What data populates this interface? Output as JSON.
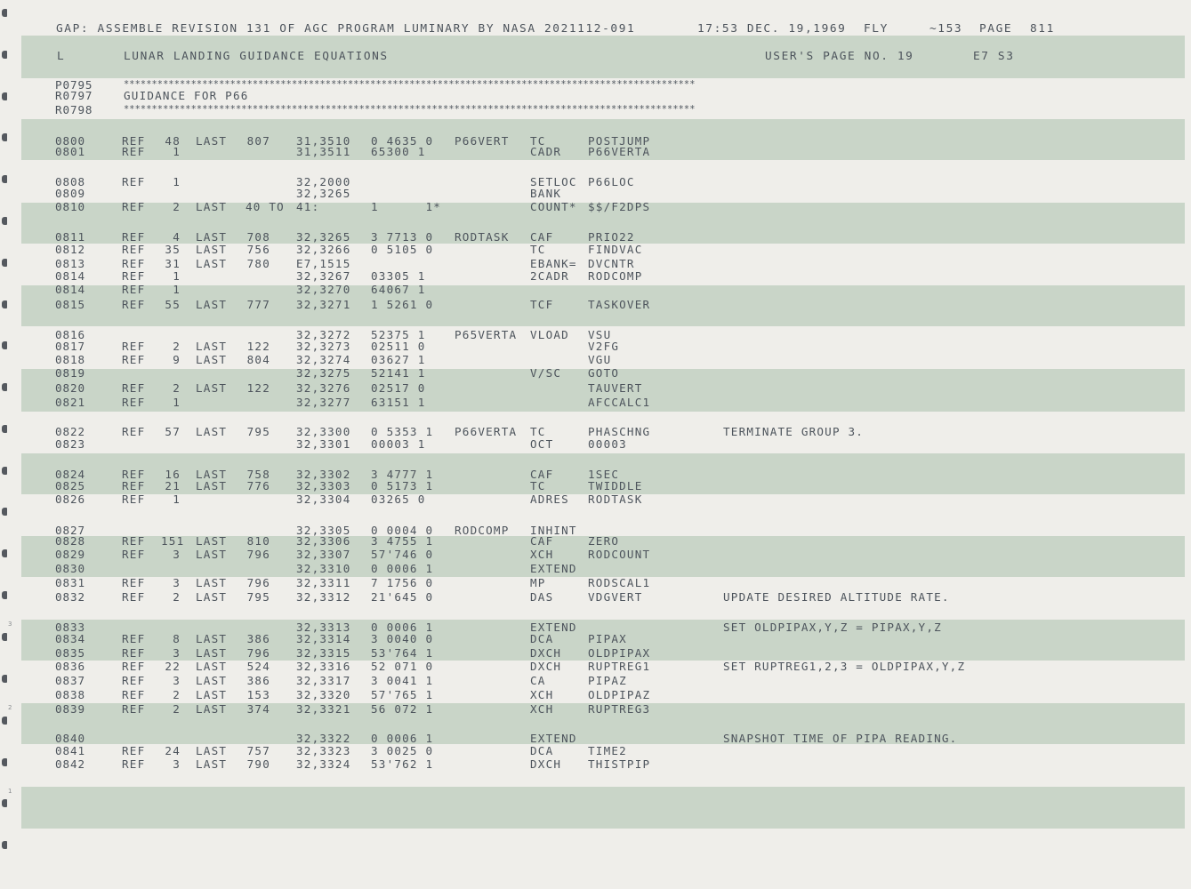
{
  "header": {
    "title": "GAP: ASSEMBLE REVISION 131 OF AGC PROGRAM LUMINARY BY NASA 2021112-091",
    "time": "17:53 DEC. 19,1969",
    "fly": "FLY",
    "num": "~153",
    "page_label": "PAGE",
    "page_num": "811"
  },
  "subheader": {
    "letter": "L",
    "title": "LUNAR LANDING GUIDANCE EQUATIONS",
    "users_page": "USER'S PAGE NO. 19",
    "code": "E7 S3"
  },
  "banner": {
    "line1_num": "P0795",
    "line1_text": "******************************************************************************************************",
    "line2_num": "R0797",
    "line2_text": "GUIDANCE FOR P66",
    "line3_num": "R0798",
    "line3_text": "******************************************************************************************************"
  },
  "rows": [
    {
      "ln": "0800",
      "ref": "REF",
      "cnt": "48",
      "last": "LAST",
      "lno": "807",
      "addr": "31,3510",
      "word": "0 4635 0",
      "label": "P66VERT",
      "op": "TC",
      "operand": "POSTJUMP",
      "comment": ""
    },
    {
      "ln": "0801",
      "ref": "REF",
      "cnt": "1",
      "last": "",
      "lno": "",
      "addr": "31,3511",
      "word": "65300 1",
      "label": "",
      "op": "CADR",
      "operand": "P66VERTA",
      "comment": ""
    },
    {
      "ln": "0808",
      "ref": "REF",
      "cnt": "1",
      "last": "",
      "lno": "",
      "addr": "32,2000",
      "word": "",
      "label": "",
      "op": "SETLOC",
      "operand": "P66LOC",
      "comment": ""
    },
    {
      "ln": "0809",
      "ref": "",
      "cnt": "",
      "last": "",
      "lno": "",
      "addr": "32,3265",
      "word": "",
      "label": "",
      "op": "BANK",
      "operand": "",
      "comment": ""
    },
    {
      "ln": "0810",
      "ref": "REF",
      "cnt": "2",
      "last": "LAST",
      "lno": "40 TO",
      "addr": "41:",
      "word": "1      1*",
      "label": "",
      "op": "COUNT*",
      "operand": "$$/F2DPS",
      "comment": ""
    },
    {
      "ln": "0811",
      "ref": "REF",
      "cnt": "4",
      "last": "LAST",
      "lno": "708",
      "addr": "32,3265",
      "word": "3 7713 0",
      "label": "RODTASK",
      "op": "CAF",
      "operand": "PRIO22",
      "comment": ""
    },
    {
      "ln": "0812",
      "ref": "REF",
      "cnt": "35",
      "last": "LAST",
      "lno": "756",
      "addr": "32,3266",
      "word": "0 5105 0",
      "label": "",
      "op": "TC",
      "operand": "FINDVAC",
      "comment": ""
    },
    {
      "ln": "0813",
      "ref": "REF",
      "cnt": "31",
      "last": "LAST",
      "lno": "780",
      "addr": "E7,1515",
      "word": "",
      "label": "",
      "op": "EBANK=",
      "operand": "DVCNTR",
      "comment": ""
    },
    {
      "ln": "0814",
      "ref": "REF",
      "cnt": "1",
      "last": "",
      "lno": "",
      "addr": "32,3267",
      "word": "03305 1",
      "label": "",
      "op": "2CADR",
      "operand": "RODCOMP",
      "comment": ""
    },
    {
      "ln": "0814",
      "ref": "REF",
      "cnt": "1",
      "last": "",
      "lno": "",
      "addr": "32,3270",
      "word": "64067 1",
      "label": "",
      "op": "",
      "operand": "",
      "comment": ""
    },
    {
      "ln": "0815",
      "ref": "REF",
      "cnt": "55",
      "last": "LAST",
      "lno": "777",
      "addr": "32,3271",
      "word": "1 5261 0",
      "label": "",
      "op": "TCF",
      "operand": "TASKOVER",
      "comment": ""
    },
    {
      "ln": "0816",
      "ref": "",
      "cnt": "",
      "last": "",
      "lno": "",
      "addr": "32,3272",
      "word": "52375 1",
      "label": "P65VERTA",
      "op": "VLOAD",
      "operand": "VSU",
      "comment": ""
    },
    {
      "ln": "0817",
      "ref": "REF",
      "cnt": "2",
      "last": "LAST",
      "lno": "122",
      "addr": "32,3273",
      "word": "02511 0",
      "label": "",
      "op": "",
      "operand": "V2FG",
      "comment": ""
    },
    {
      "ln": "0818",
      "ref": "REF",
      "cnt": "9",
      "last": "LAST",
      "lno": "804",
      "addr": "32,3274",
      "word": "03627 1",
      "label": "",
      "op": "",
      "operand": "VGU",
      "comment": ""
    },
    {
      "ln": "0819",
      "ref": "",
      "cnt": "",
      "last": "",
      "lno": "",
      "addr": "32,3275",
      "word": "52141 1",
      "label": "",
      "op": "V/SC",
      "operand": "GOTO",
      "comment": ""
    },
    {
      "ln": "0820",
      "ref": "REF",
      "cnt": "2",
      "last": "LAST",
      "lno": "122",
      "addr": "32,3276",
      "word": "02517 0",
      "label": "",
      "op": "",
      "operand": "TAUVERT",
      "comment": ""
    },
    {
      "ln": "0821",
      "ref": "REF",
      "cnt": "1",
      "last": "",
      "lno": "",
      "addr": "32,3277",
      "word": "63151 1",
      "label": "",
      "op": "",
      "operand": "AFCCALC1",
      "comment": ""
    },
    {
      "ln": "0822",
      "ref": "REF",
      "cnt": "57",
      "last": "LAST",
      "lno": "795",
      "addr": "32,3300",
      "word": "0 5353 1",
      "label": "P66VERTA",
      "op": "TC",
      "operand": "PHASCHNG",
      "comment": "TERMINATE GROUP 3."
    },
    {
      "ln": "0823",
      "ref": "",
      "cnt": "",
      "last": "",
      "lno": "",
      "addr": "32,3301",
      "word": "00003 1",
      "label": "",
      "op": "OCT",
      "operand": "00003",
      "comment": ""
    },
    {
      "ln": "0824",
      "ref": "REF",
      "cnt": "16",
      "last": "LAST",
      "lno": "758",
      "addr": "32,3302",
      "word": "3 4777 1",
      "label": "",
      "op": "CAF",
      "operand": "1SEC",
      "comment": ""
    },
    {
      "ln": "0825",
      "ref": "REF",
      "cnt": "21",
      "last": "LAST",
      "lno": "776",
      "addr": "32,3303",
      "word": "0 5173 1",
      "label": "",
      "op": "TC",
      "operand": "TWIDDLE",
      "comment": ""
    },
    {
      "ln": "0826",
      "ref": "REF",
      "cnt": "1",
      "last": "",
      "lno": "",
      "addr": "32,3304",
      "word": "03265 0",
      "label": "",
      "op": "ADRES",
      "operand": "RODTASK",
      "comment": ""
    },
    {
      "ln": "0827",
      "ref": "",
      "cnt": "",
      "last": "",
      "lno": "",
      "addr": "32,3305",
      "word": "0 0004 0",
      "label": "RODCOMP",
      "op": "INHINT",
      "operand": "",
      "comment": ""
    },
    {
      "ln": "0828",
      "ref": "REF",
      "cnt": "151",
      "last": "LAST",
      "lno": "810",
      "addr": "32,3306",
      "word": "3 4755 1",
      "label": "",
      "op": "CAF",
      "operand": "ZERO",
      "comment": ""
    },
    {
      "ln": "0829",
      "ref": "REF",
      "cnt": "3",
      "last": "LAST",
      "lno": "796",
      "addr": "32,3307",
      "word": "57'746 0",
      "label": "",
      "op": "XCH",
      "operand": "RODCOUNT",
      "comment": ""
    },
    {
      "ln": "0830",
      "ref": "",
      "cnt": "",
      "last": "",
      "lno": "",
      "addr": "32,3310",
      "word": "0 0006 1",
      "label": "",
      "op": "EXTEND",
      "operand": "",
      "comment": ""
    },
    {
      "ln": "0831",
      "ref": "REF",
      "cnt": "3",
      "last": "LAST",
      "lno": "796",
      "addr": "32,3311",
      "word": "7 1756 0",
      "label": "",
      "op": "MP",
      "operand": "RODSCAL1",
      "comment": ""
    },
    {
      "ln": "0832",
      "ref": "REF",
      "cnt": "2",
      "last": "LAST",
      "lno": "795",
      "addr": "32,3312",
      "word": "21'645 0",
      "label": "",
      "op": "DAS",
      "operand": "VDGVERT",
      "comment": "UPDATE DESIRED ALTITUDE RATE."
    },
    {
      "ln": "0833",
      "ref": "",
      "cnt": "",
      "last": "",
      "lno": "",
      "addr": "32,3313",
      "word": "0 0006 1",
      "label": "",
      "op": "EXTEND",
      "operand": "",
      "comment": "SET OLDPIPAX,Y,Z = PIPAX,Y,Z"
    },
    {
      "ln": "0834",
      "ref": "REF",
      "cnt": "8",
      "last": "LAST",
      "lno": "386",
      "addr": "32,3314",
      "word": "3 0040 0",
      "label": "",
      "op": "DCA",
      "operand": "PIPAX",
      "comment": ""
    },
    {
      "ln": "0835",
      "ref": "REF",
      "cnt": "3",
      "last": "LAST",
      "lno": "796",
      "addr": "32,3315",
      "word": "53'764 1",
      "label": "",
      "op": "DXCH",
      "operand": "OLDPIPAX",
      "comment": ""
    },
    {
      "ln": "0836",
      "ref": "REF",
      "cnt": "22",
      "last": "LAST",
      "lno": "524",
      "addr": "32,3316",
      "word": "52 071 0",
      "label": "",
      "op": "DXCH",
      "operand": "RUPTREG1",
      "comment": "SET RUPTREG1,2,3 = OLDPIPAX,Y,Z"
    },
    {
      "ln": "0837",
      "ref": "REF",
      "cnt": "3",
      "last": "LAST",
      "lno": "386",
      "addr": "32,3317",
      "word": "3 0041 1",
      "label": "",
      "op": "CA",
      "operand": "PIPAZ",
      "comment": ""
    },
    {
      "ln": "0838",
      "ref": "REF",
      "cnt": "2",
      "last": "LAST",
      "lno": "153",
      "addr": "32,3320",
      "word": "57'765 1",
      "label": "",
      "op": "XCH",
      "operand": "OLDPIPAZ",
      "comment": ""
    },
    {
      "ln": "0839",
      "ref": "REF",
      "cnt": "2",
      "last": "LAST",
      "lno": "374",
      "addr": "32,3321",
      "word": "56 072 1",
      "label": "",
      "op": "XCH",
      "operand": "RUPTREG3",
      "comment": ""
    },
    {
      "ln": "0840",
      "ref": "",
      "cnt": "",
      "last": "",
      "lno": "",
      "addr": "32,3322",
      "word": "0 0006 1",
      "label": "",
      "op": "EXTEND",
      "operand": "",
      "comment": "SNAPSHOT TIME OF PIPA READING."
    },
    {
      "ln": "0841",
      "ref": "REF",
      "cnt": "24",
      "last": "LAST",
      "lno": "757",
      "addr": "32,3323",
      "word": "3 0025 0",
      "label": "",
      "op": "DCA",
      "operand": "TIME2",
      "comment": ""
    },
    {
      "ln": "0842",
      "ref": "REF",
      "cnt": "3",
      "last": "LAST",
      "lno": "790",
      "addr": "32,3324",
      "word": "53'762 1",
      "label": "",
      "op": "DXCH",
      "operand": "THISTPIP",
      "comment": ""
    }
  ],
  "margin_marks": [
    "3",
    "2",
    "1"
  ]
}
